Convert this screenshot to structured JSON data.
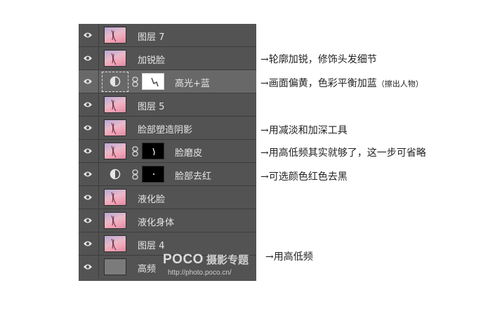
{
  "layers": [
    {
      "name": "图层 7",
      "thumb": "photo"
    },
    {
      "name": "加锐脸",
      "thumb": "photo"
    },
    {
      "name": "高光+蓝",
      "thumb": "adjustment",
      "mask": "white",
      "selected": true
    },
    {
      "name": "图层 5",
      "thumb": "photo"
    },
    {
      "name": "脸部塑造阴影",
      "thumb": "photo"
    },
    {
      "name": "脸磨皮",
      "thumb": "photo",
      "mask": "black"
    },
    {
      "name": "脸部去红",
      "thumb": "adjustment",
      "mask": "black"
    },
    {
      "name": "液化脸",
      "thumb": "photo"
    },
    {
      "name": "液化身体",
      "thumb": "photo"
    },
    {
      "name": "图层 4",
      "thumb": "photo"
    },
    {
      "name": "高频",
      "thumb": "gray"
    }
  ],
  "annotations": {
    "a1": "→轮廓加锐，修饰头发细节",
    "a2": "→画面偏黄，色彩平衡加蓝",
    "a2_small": "（擦出人物）",
    "a3": "→用减淡和加深工具",
    "a4": "→用高低频其实就够了，这一步可省略",
    "a5": "→可选颜色红色去黑",
    "a6": "→用高低频"
  },
  "watermark": {
    "brand": "POCO",
    "cn": "摄影专题",
    "url": "http://photo.poco.cn/"
  },
  "colors": {
    "panel": "#535353",
    "selected_row": "#686868",
    "layer_text": "#e6e6e6",
    "annotation_text": "#222222"
  },
  "icons": {
    "visibility": "eye-icon",
    "link": "chain-link-icon",
    "adjustment": "adjustment-layer-icon"
  }
}
